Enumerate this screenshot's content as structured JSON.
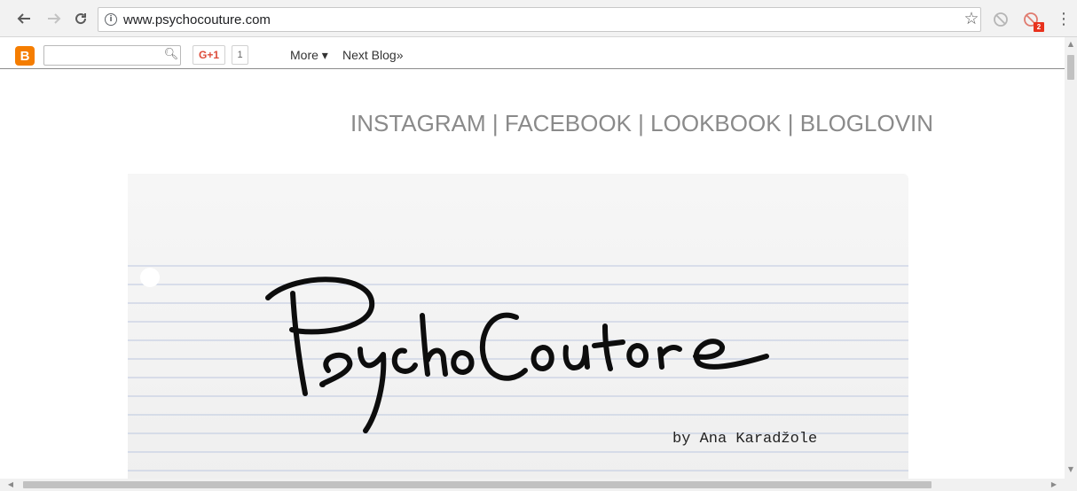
{
  "browser": {
    "back_icon": "arrow-left",
    "forward_icon": "arrow-right",
    "reload_icon": "reload",
    "url": "www.psychocouture.com",
    "extension_badge": "2"
  },
  "navbar": {
    "gplus_label": "G+1",
    "gplus_count": "1",
    "more_label": "More ▾",
    "next_blog_label": "Next Blog»"
  },
  "social": {
    "instagram": "INSTAGRAM",
    "facebook": "FACEBOOK",
    "lookbook": "LOOKBOOK",
    "bloglovin": "BLOGLOVIN",
    "separator": "|"
  },
  "header": {
    "logo_text": "PsychoCouture",
    "byline": "by Ana Karadžole"
  },
  "colors": {
    "blogger_orange": "#f57d00",
    "gplus_red": "#dd4b39",
    "link_gray": "#8a8a8a"
  }
}
